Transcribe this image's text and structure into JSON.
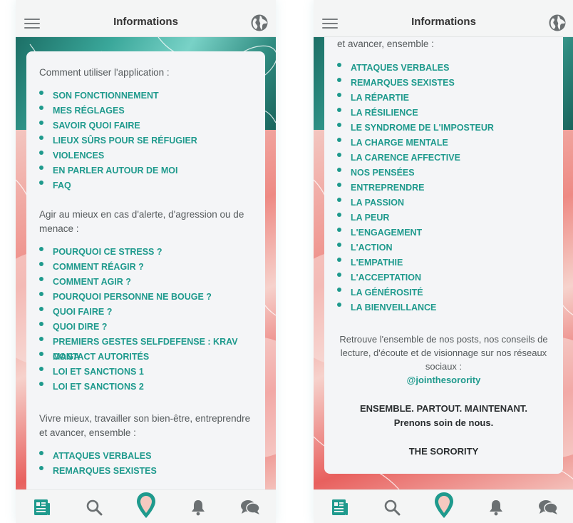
{
  "app": {
    "title": "Informations"
  },
  "colors": {
    "accent": "#1f9a8d",
    "text": "#555a5c",
    "header_bg": "#f4f5f5"
  },
  "icons": {
    "menu": "hamburger-menu-icon",
    "globe": "globe-icon",
    "tabs": [
      "newspaper-icon",
      "search-icon",
      "location-pin-icon",
      "bell-icon",
      "chat-bubbles-icon"
    ]
  },
  "left": {
    "section1": {
      "intro": "Comment utiliser l'application :",
      "items": [
        "SON FONCTIONNEMENT",
        "MES RÉGLAGES",
        "SAVOIR QUOI FAIRE",
        "LIEUX SÛRS POUR SE RÉFUGIER",
        "VIOLENCES",
        "EN PARLER AUTOUR DE MOI",
        "FAQ"
      ]
    },
    "section2": {
      "intro": "Agir au mieux en cas d'alerte, d'agression ou de menace :",
      "items": [
        "POURQUOI CE STRESS ?",
        "COMMENT RÉAGIR ?",
        "COMMENT AGIR ?",
        "POURQUOI PERSONNE NE BOUGE ?",
        "QUOI FAIRE ?",
        "QUOI DIRE ?",
        "PREMIERS GESTES SELFDEFENSE : KRAV MAGA",
        "CONTACT AUTORITÉS",
        "LOI ET SANCTIONS 1",
        "LOI ET SANCTIONS 2"
      ]
    },
    "section3": {
      "intro": "Vivre mieux, travailler son bien-être, entreprendre et avancer, ensemble :",
      "items": [
        "ATTAQUES VERBALES",
        "REMARQUES SEXISTES"
      ]
    }
  },
  "right": {
    "intro_tail": "et avancer, ensemble :",
    "items": [
      "ATTAQUES VERBALES",
      "REMARQUES SEXISTES",
      "LA RÉPARTIE",
      "LA RÉSILIENCE",
      "LE SYNDROME DE L'IMPOSTEUR",
      "LA CHARGE MENTALE",
      "LA CARENCE AFFECTIVE",
      "NOS PENSÉES",
      "ENTREPRENDRE",
      "LA PASSION",
      "LA PEUR",
      "L'ENGAGEMENT",
      "L'ACTION",
      "L'EMPATHIE",
      "L'ACCEPTATION",
      "LA GÉNÉROSITÉ",
      "LA BIENVEILLANCE"
    ],
    "footer_text": "Retrouve l'ensemble de nos posts, nos conseils de lecture, d'écoute et de visionnage sur nos réseaux sociaux :",
    "handle": "@jointhesorority",
    "motto_line1": "ENSEMBLE. PARTOUT. MAINTENANT.",
    "motto_line2": "Prenons soin de nous.",
    "signature": "THE SORORITY"
  }
}
